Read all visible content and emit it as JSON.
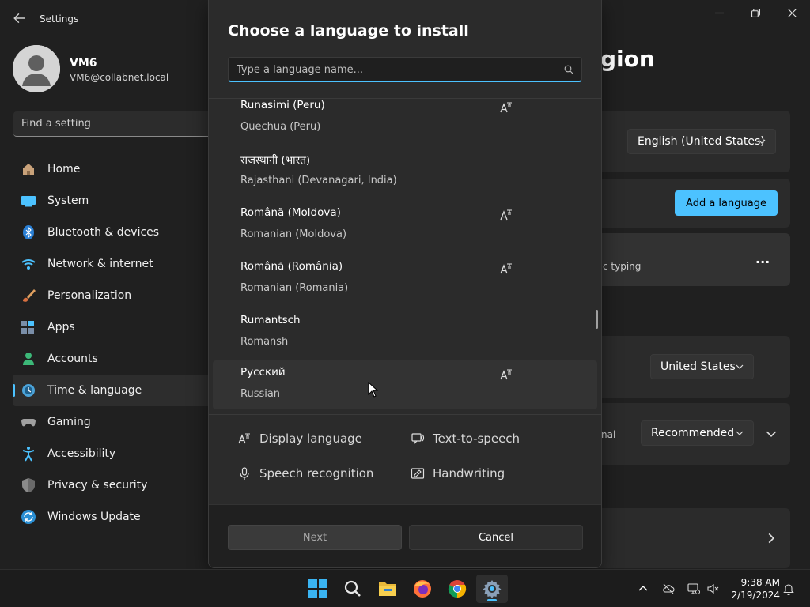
{
  "window": {
    "title": "Settings"
  },
  "profile": {
    "name": "VM6",
    "email": "VM6@collabnet.local"
  },
  "search": {
    "placeholder": "Find a setting"
  },
  "nav": {
    "items": [
      {
        "label": "Home",
        "icon": "home-icon"
      },
      {
        "label": "System",
        "icon": "system-icon"
      },
      {
        "label": "Bluetooth & devices",
        "icon": "bluetooth-icon"
      },
      {
        "label": "Network & internet",
        "icon": "network-icon"
      },
      {
        "label": "Personalization",
        "icon": "brush-icon"
      },
      {
        "label": "Apps",
        "icon": "apps-icon"
      },
      {
        "label": "Accounts",
        "icon": "accounts-icon"
      },
      {
        "label": "Time & language",
        "icon": "time-language-icon",
        "active": true
      },
      {
        "label": "Gaming",
        "icon": "gaming-icon"
      },
      {
        "label": "Accessibility",
        "icon": "accessibility-icon"
      },
      {
        "label": "Privacy & security",
        "icon": "shield-icon"
      },
      {
        "label": "Windows Update",
        "icon": "update-icon"
      }
    ]
  },
  "background": {
    "title_fragment": "egion",
    "display_language_value": "English (United States)",
    "add_language_label": "Add a language",
    "typing_fragment": "c typing",
    "more_label": "...",
    "country_value": "United States",
    "regional_fragment": "nal",
    "format_value": "Recommended"
  },
  "dialog": {
    "title": "Choose a language to install",
    "search_placeholder": "Type a language name...",
    "languages": [
      {
        "native": "Runasimi (Peru)",
        "english": "Quechua (Peru)",
        "display_language": true
      },
      {
        "native": "राजस्थानी (भारत)",
        "english": "Rajasthani (Devanagari, India)",
        "display_language": false
      },
      {
        "native": "Română (Moldova)",
        "english": "Romanian (Moldova)",
        "display_language": true
      },
      {
        "native": "Română (România)",
        "english": "Romanian (Romania)",
        "display_language": true
      },
      {
        "native": "Rumantsch",
        "english": "Romansh",
        "display_language": false
      },
      {
        "native": "Русский",
        "english": "Russian",
        "display_language": true,
        "hovered": true
      }
    ],
    "legend": {
      "display_language": "Display language",
      "text_to_speech": "Text-to-speech",
      "speech_recognition": "Speech recognition",
      "handwriting": "Handwriting"
    },
    "next_label": "Next",
    "cancel_label": "Cancel"
  },
  "taskbar": {
    "apps": [
      "start-icon",
      "search-icon",
      "file-explorer-icon",
      "firefox-icon",
      "chrome-icon",
      "settings-icon"
    ],
    "time": "9:38 AM",
    "date": "2/19/2024"
  },
  "colors": {
    "accent": "#4cc2ff",
    "background": "#202020",
    "dialog": "#2b2b2b"
  }
}
